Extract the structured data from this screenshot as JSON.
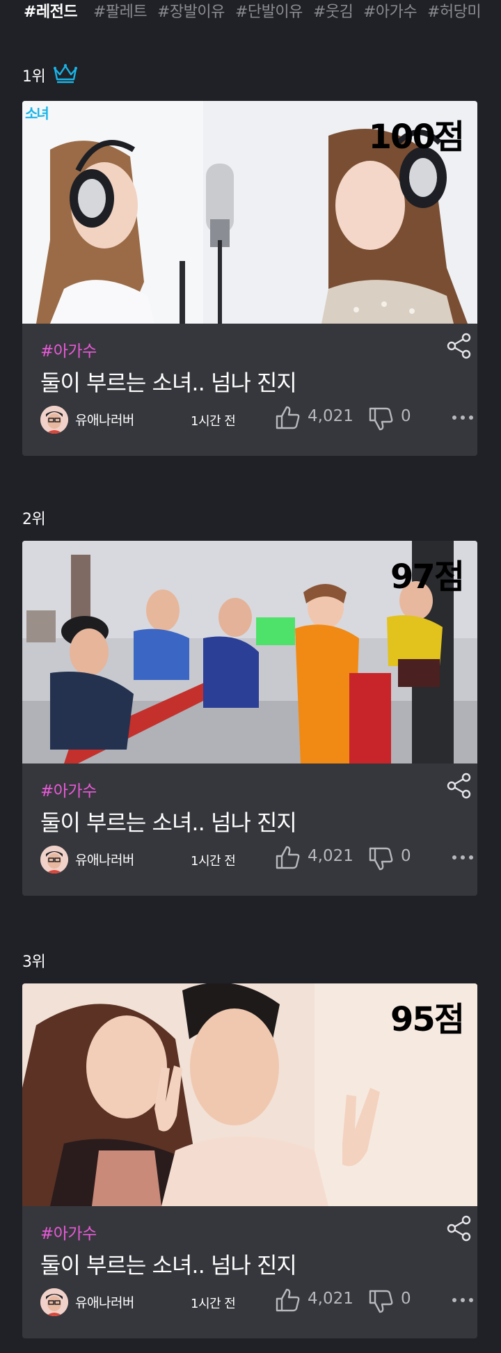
{
  "tag_bar": {
    "tags": [
      {
        "label": "#레전드",
        "active": true
      },
      {
        "label": "#팔레트",
        "active": false
      },
      {
        "label": "#장발이유",
        "active": false
      },
      {
        "label": "#단발이유",
        "active": false
      },
      {
        "label": "#웃김",
        "active": false
      },
      {
        "label": "#아가수",
        "active": false
      },
      {
        "label": "#허당미",
        "active": false
      }
    ]
  },
  "cards": [
    {
      "rank_label": "1위",
      "score": "100점",
      "badge": "소녀",
      "hashtag": "#아가수",
      "title": "둘이 부르는 소녀.. 넘나 진지",
      "author": "유애나러버",
      "time": "1시간 전",
      "likes": "4,021",
      "dislikes": "0"
    },
    {
      "rank_label": "2위",
      "score": "97점",
      "hashtag": "#아가수",
      "title": "둘이 부르는 소녀.. 넘나 진지",
      "author": "유애나러버",
      "time": "1시간 전",
      "likes": "4,021",
      "dislikes": "0"
    },
    {
      "rank_label": "3위",
      "score": "95점",
      "hashtag": "#아가수",
      "title": "둘이 부르는 소녀.. 넘나 진지",
      "author": "유애나러버",
      "time": "1시간 전",
      "likes": "4,021",
      "dislikes": "0"
    }
  ],
  "colors": {
    "background": "#202126",
    "card": "#36373c",
    "hashtag": "#e85ad8",
    "crown": "#19b5e8",
    "muted": "#b8b9bd"
  },
  "icons": {
    "crown": "crown-icon",
    "share": "share-icon",
    "like": "thumbs-up-icon",
    "dislike": "thumbs-down-icon",
    "more": "more-dots-icon"
  }
}
